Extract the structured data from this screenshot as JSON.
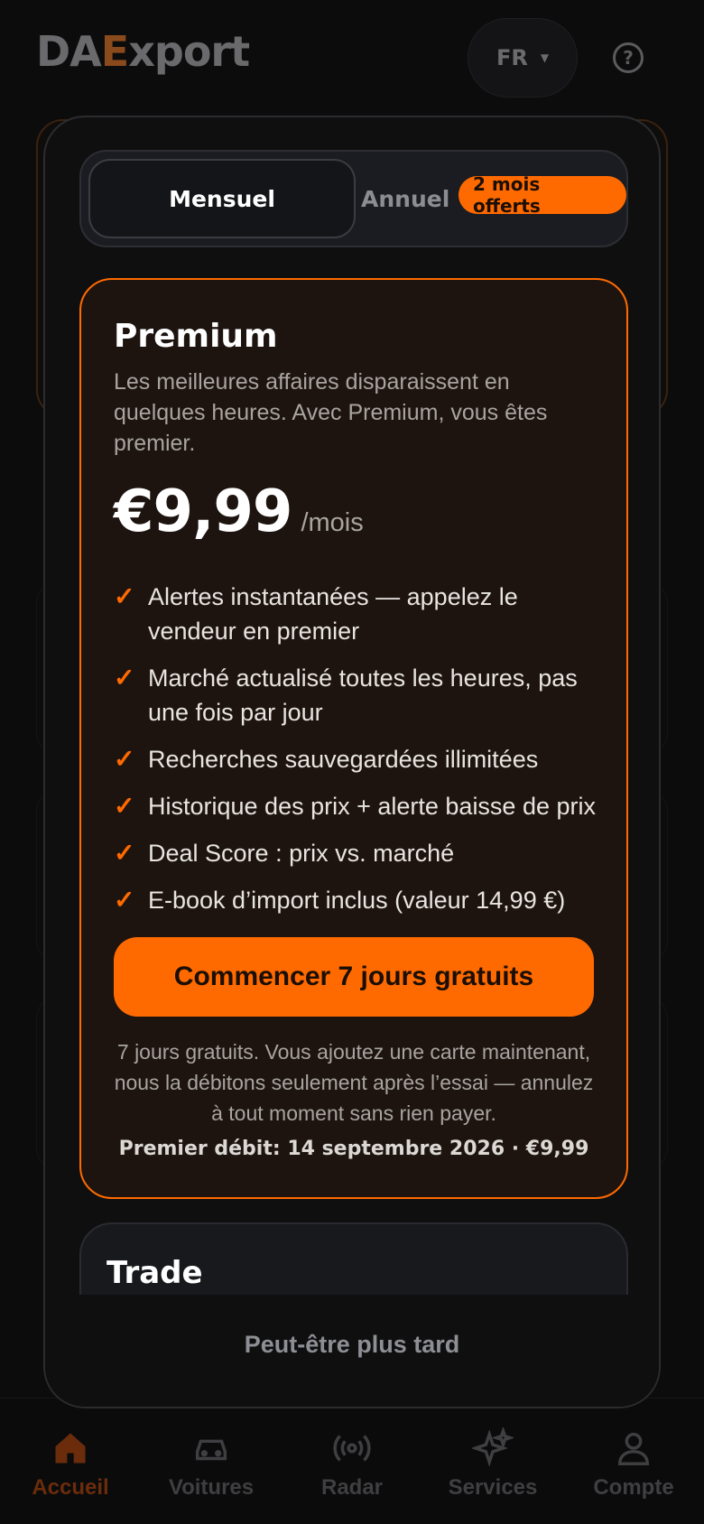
{
  "app": {
    "logo_text": "DAExport",
    "language": "FR"
  },
  "toggle": {
    "monthly_label": "Mensuel",
    "annual_label": "Annuel",
    "offer_badge": "2 mois offerts"
  },
  "plan": {
    "name": "Premium",
    "description": "Les meilleures affaires disparaissent en quelques heures. Avec Premium, vous êtes premier.",
    "price": "€9,99",
    "period": "/mois",
    "features": [
      "Alertes instantanées — appelez le vendeur en premier",
      "Marché actualisé toutes les heures, pas une fois par jour",
      "Recherches sauvegardées illimitées",
      "Historique des prix + alerte baisse de prix",
      "Deal Score : prix vs. marché",
      "E-book d’import inclus (valeur 14,99 €)"
    ],
    "cta_label": "Commencer 7 jours gratuits",
    "trial_note": "7 jours gratuits. Vous ajoutez une carte maintenant, nous la débitons seulement après l’essai — annulez à tout moment sans rien payer.",
    "first_charge": "Premier débit: 14 septembre 2026 · €9,99"
  },
  "trade_plan": {
    "name": "Trade"
  },
  "later_label": "Peut-être plus tard",
  "bottom_nav": [
    {
      "label": "Accueil",
      "icon": "home-icon",
      "active": true
    },
    {
      "label": "Voitures",
      "icon": "car-icon",
      "active": false
    },
    {
      "label": "Radar",
      "icon": "radar-icon",
      "active": false
    },
    {
      "label": "Services",
      "icon": "sparkles-icon",
      "active": false
    },
    {
      "label": "Compte",
      "icon": "user-icon",
      "active": false
    }
  ],
  "colors": {
    "accent": "#ff6a00",
    "card_bg": "#1d1410",
    "modal_bg": "#0f0f10"
  }
}
